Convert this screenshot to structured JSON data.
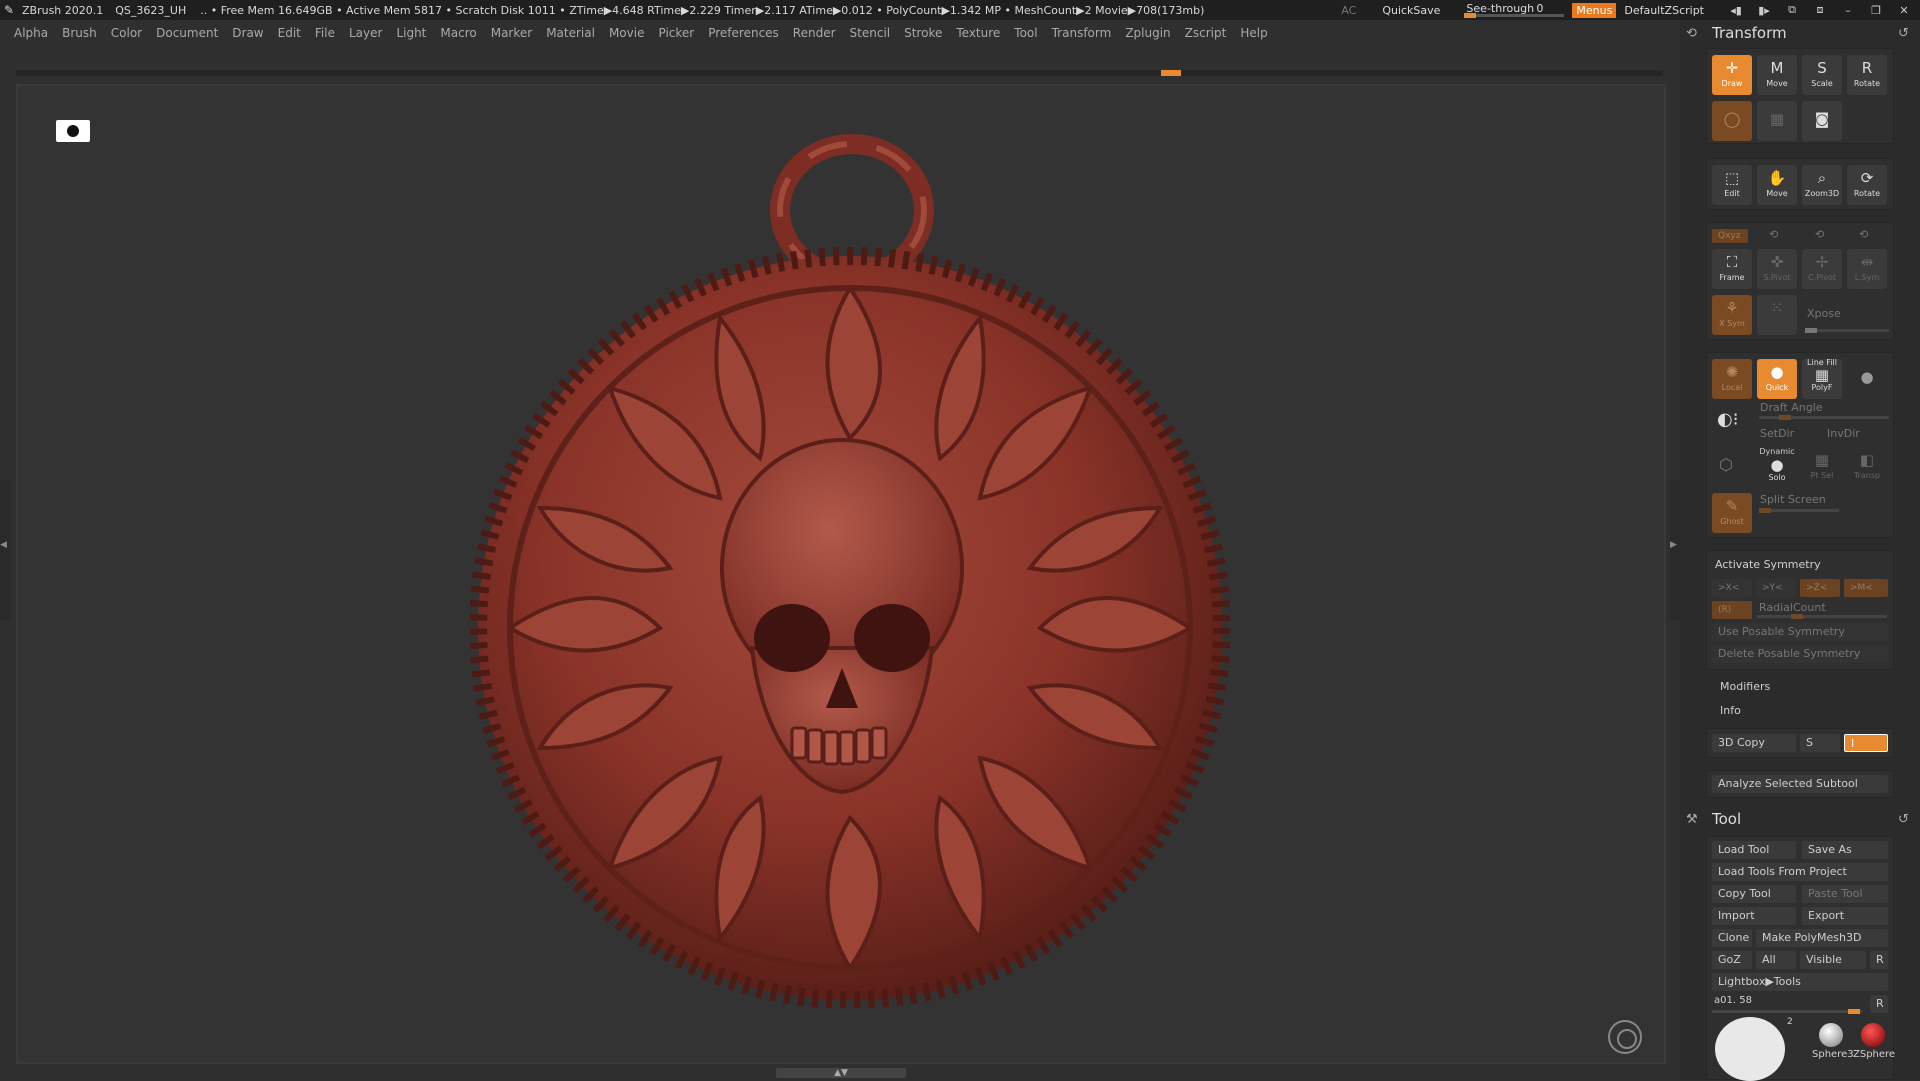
{
  "app": {
    "title": "ZBrush 2020.1",
    "project": "QS_3623_UH",
    "stats": ".. • Free Mem 16.649GB • Active Mem 5817 • Scratch Disk 1011 • ZTime▶4.648 RTime▶2.229 Timer▶2.117 ATime▶0.012 • PolyCount▶1.342 MP • MeshCount▶2 Movie▶708(173mb)",
    "ac": "AC",
    "quicksave": "QuickSave",
    "see_through_label": "See-through",
    "see_through_value": "0",
    "menus_label": "Menus",
    "zscript": "DefaultZScript"
  },
  "menubar": [
    "Alpha",
    "Brush",
    "Color",
    "Document",
    "Draw",
    "Edit",
    "File",
    "Layer",
    "Light",
    "Macro",
    "Marker",
    "Material",
    "Movie",
    "Picker",
    "Preferences",
    "Render",
    "Stencil",
    "Stroke",
    "Texture",
    "Tool",
    "Transform",
    "Zplugin",
    "Zscript",
    "Help"
  ],
  "transform": {
    "title": "Transform",
    "row1": [
      "Draw",
      "Move",
      "Scale",
      "Rotate"
    ],
    "row3": [
      "Edit",
      "Move",
      "Zoom3D",
      "Rotate"
    ],
    "xyz": "Qxyz",
    "frame": "Frame",
    "spivot": "S.Pivot",
    "cpivot": "C.Pivot",
    "lsym": "L.Sym",
    "xsym": "X Sym",
    "xpose": "Xpose",
    "local": "Local",
    "quick": "Quick",
    "line_fill": "Line Fill",
    "polyf": "PolyF",
    "draft_angle": "Draft Angle",
    "setdir": "SetDir",
    "invdir": "InvDir",
    "dynamic": "Dynamic",
    "solo": "Solo",
    "ptsel": "Pt Sel",
    "transp": "Transp",
    "ghost": "Ghost",
    "split_screen": "Split Screen",
    "activate_symmetry": "Activate Symmetry",
    "sym_x": ">X<",
    "sym_y": ">Y<",
    "sym_z": ">Z<",
    "sym_m": ">M<",
    "sym_r": "(R)",
    "radial_count": "RadialCount",
    "use_posable": "Use Posable Symmetry",
    "delete_posable": "Delete Posable Symmetry",
    "modifiers": "Modifiers",
    "info": "Info",
    "copy3d": "3D Copy",
    "copy3d_s": "S",
    "copy3d_i": "I",
    "analyze": "Analyze Selected Subtool"
  },
  "tool": {
    "title": "Tool",
    "load_tool": "Load Tool",
    "save_as": "Save As",
    "load_from_project": "Load Tools From Project",
    "copy_tool": "Copy Tool",
    "paste_tool": "Paste Tool",
    "import": "Import",
    "export": "Export",
    "clone": "Clone",
    "make_polymesh": "Make PolyMesh3D",
    "goz": "GoZ",
    "all": "All",
    "visible": "Visible",
    "r": "R",
    "lightbox_tools": "Lightbox▶Tools",
    "current_tool": "a01. 58",
    "thumb_count": "2",
    "thumb_sphere3": "Sphere3",
    "thumb_zsphere": "ZSphere"
  },
  "colors": {
    "accent": "#e88a2f",
    "pendant": "#8a3328",
    "pendant_dark": "#5a1f18",
    "pendant_light": "#b0574a"
  }
}
